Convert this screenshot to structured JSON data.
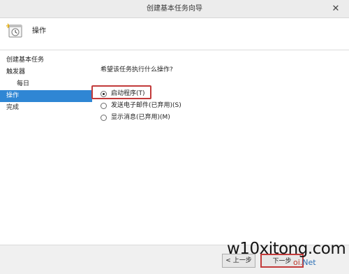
{
  "window": {
    "title": "创建基本任务向导",
    "close_glyph": "✕"
  },
  "header": {
    "title": "操作",
    "icon": "task-clock-icon"
  },
  "sidebar": {
    "items": [
      {
        "label": "创建基本任务",
        "level": 0,
        "active": false
      },
      {
        "label": "触发器",
        "level": 0,
        "active": false
      },
      {
        "label": "每日",
        "level": 1,
        "active": false
      },
      {
        "label": "操作",
        "level": 0,
        "active": true
      },
      {
        "label": "完成",
        "level": 0,
        "active": false
      }
    ]
  },
  "content": {
    "question": "希望该任务执行什么操作?",
    "options": [
      {
        "label": "启动程序(T)",
        "checked": true
      },
      {
        "label": "发送电子邮件(已弃用)(S)",
        "checked": false
      },
      {
        "label": "显示消息(已弃用)(M)",
        "checked": false
      }
    ]
  },
  "footer": {
    "back_label": "< 上一步",
    "next_label": "下一步"
  },
  "watermark": {
    "main": "w10xitong.com",
    "sub_a": "oi.",
    "sub_b": "Net"
  },
  "colors": {
    "accent": "#2f86d4",
    "highlight": "#c23a3a"
  }
}
